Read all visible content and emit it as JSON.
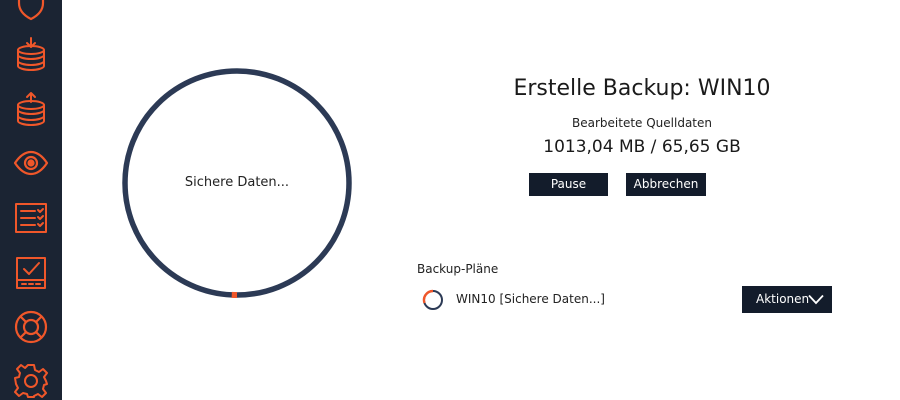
{
  "colors": {
    "sidebar_bg": "#1b2433",
    "accent_orange": "#f0572a",
    "ring_navy": "#2c3a55",
    "button_bg": "#131c2b"
  },
  "sidebar": {
    "items": [
      {
        "icon": "shield-icon"
      },
      {
        "icon": "database-download-icon"
      },
      {
        "icon": "database-upload-icon"
      },
      {
        "icon": "eye-icon"
      },
      {
        "icon": "checklist-icon"
      },
      {
        "icon": "drive-check-icon"
      },
      {
        "icon": "lifebuoy-icon"
      },
      {
        "icon": "gear-icon"
      }
    ]
  },
  "progress": {
    "ring_label": "Sichere Daten...",
    "ring_fraction": 0.015
  },
  "backup": {
    "title": "Erstelle Backup: WIN10",
    "subtitle": "Bearbeitete Quelldaten",
    "progress_text": "1013,04 MB / 65,65 GB",
    "pause_label": "Pause",
    "cancel_label": "Abbrechen"
  },
  "plans": {
    "header": "Backup-Pläne",
    "items": [
      {
        "name": "WIN10 [Sichere Daten...]"
      }
    ],
    "actions_label": "Aktionen"
  }
}
